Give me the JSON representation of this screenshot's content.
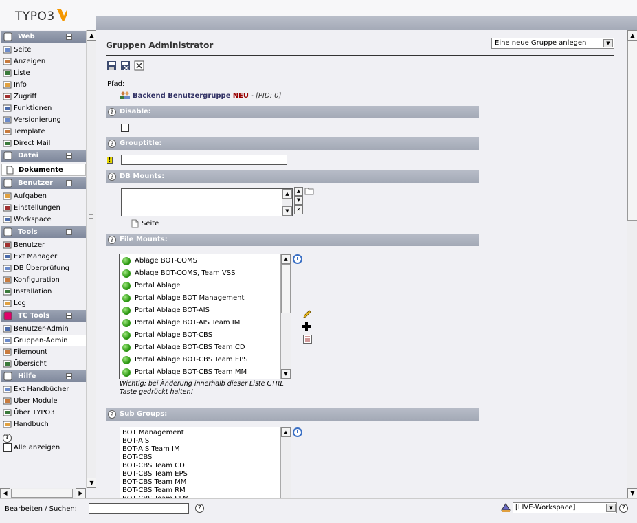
{
  "app": {
    "logo_text": "TYPO3"
  },
  "left_menu": {
    "groups": [
      {
        "title": "Web",
        "toggle": "−",
        "items": [
          "Seite",
          "Anzeigen",
          "Liste",
          "Info",
          "Zugriff",
          "Funktionen",
          "Versionierung",
          "Template",
          "Direct Mail"
        ]
      },
      {
        "title": "Datei",
        "toggle": "+",
        "items": []
      },
      {
        "link": "Dokumente"
      },
      {
        "title": "Benutzer",
        "toggle": "−",
        "items": [
          "Aufgaben",
          "Einstellungen",
          "Workspace"
        ]
      },
      {
        "title": "Tools",
        "toggle": "−",
        "items": [
          "Benutzer",
          "Ext Manager",
          "DB Überprüfung",
          "Konfiguration",
          "Installation",
          "Log"
        ]
      },
      {
        "title": "TC Tools",
        "toggle": "−",
        "items": [
          "Benutzer-Admin",
          "Gruppen-Admin",
          "Filemount",
          "Übersicht"
        ],
        "active": "Gruppen-Admin"
      },
      {
        "title": "Hilfe",
        "toggle": "−",
        "items": [
          "Ext Handbücher",
          "Über Module",
          "Über TYPO3",
          "Handbuch"
        ]
      }
    ],
    "help_symbol": "?",
    "show_all_label": "Alle anzeigen"
  },
  "main": {
    "title": "Gruppen Administrator",
    "new_group_select": "Eine neue Gruppe anlegen",
    "path_label": "Pfad:",
    "path_title": "Backend Benutzergruppe",
    "path_new": "NEU",
    "path_sep": " - ",
    "path_pid": "[PID: 0]",
    "sections": {
      "disable": "Disable:",
      "grouptitle": "Grouptitle:",
      "db_mounts": "DB Mounts:",
      "file_mounts": "File Mounts:",
      "sub_groups": "Sub Groups:"
    },
    "db_mounts_page_label": "Seite",
    "file_mounts_items": [
      "Ablage BOT-COMS",
      "Ablage BOT-COMS, Team VSS",
      "Portal Ablage",
      "Portal Ablage BOT Management",
      "Portal Ablage BOT-AIS",
      "Portal Ablage BOT-AIS Team IM",
      "Portal Ablage BOT-CBS",
      "Portal Ablage BOT-CBS Team CD",
      "Portal Ablage BOT-CBS Team EPS",
      "Portal Ablage BOT-CBS Team MM"
    ],
    "file_mounts_note": "Wichtig: bei Änderung innerhalb dieser Liste CTRL Taste gedrückt halten!",
    "sub_group_items": [
      "BOT Management",
      "BOT-AIS",
      "BOT-AIS Team IM",
      "BOT-CBS",
      "BOT-CBS Team CD",
      "BOT-CBS Team EPS",
      "BOT-CBS Team MM",
      "BOT-CBS Team RM",
      "BOT-CBS Team SLM"
    ]
  },
  "bottom": {
    "search_label": "Bearbeiten / Suchen:",
    "workspace_select": "[LIVE-Workspace]"
  }
}
